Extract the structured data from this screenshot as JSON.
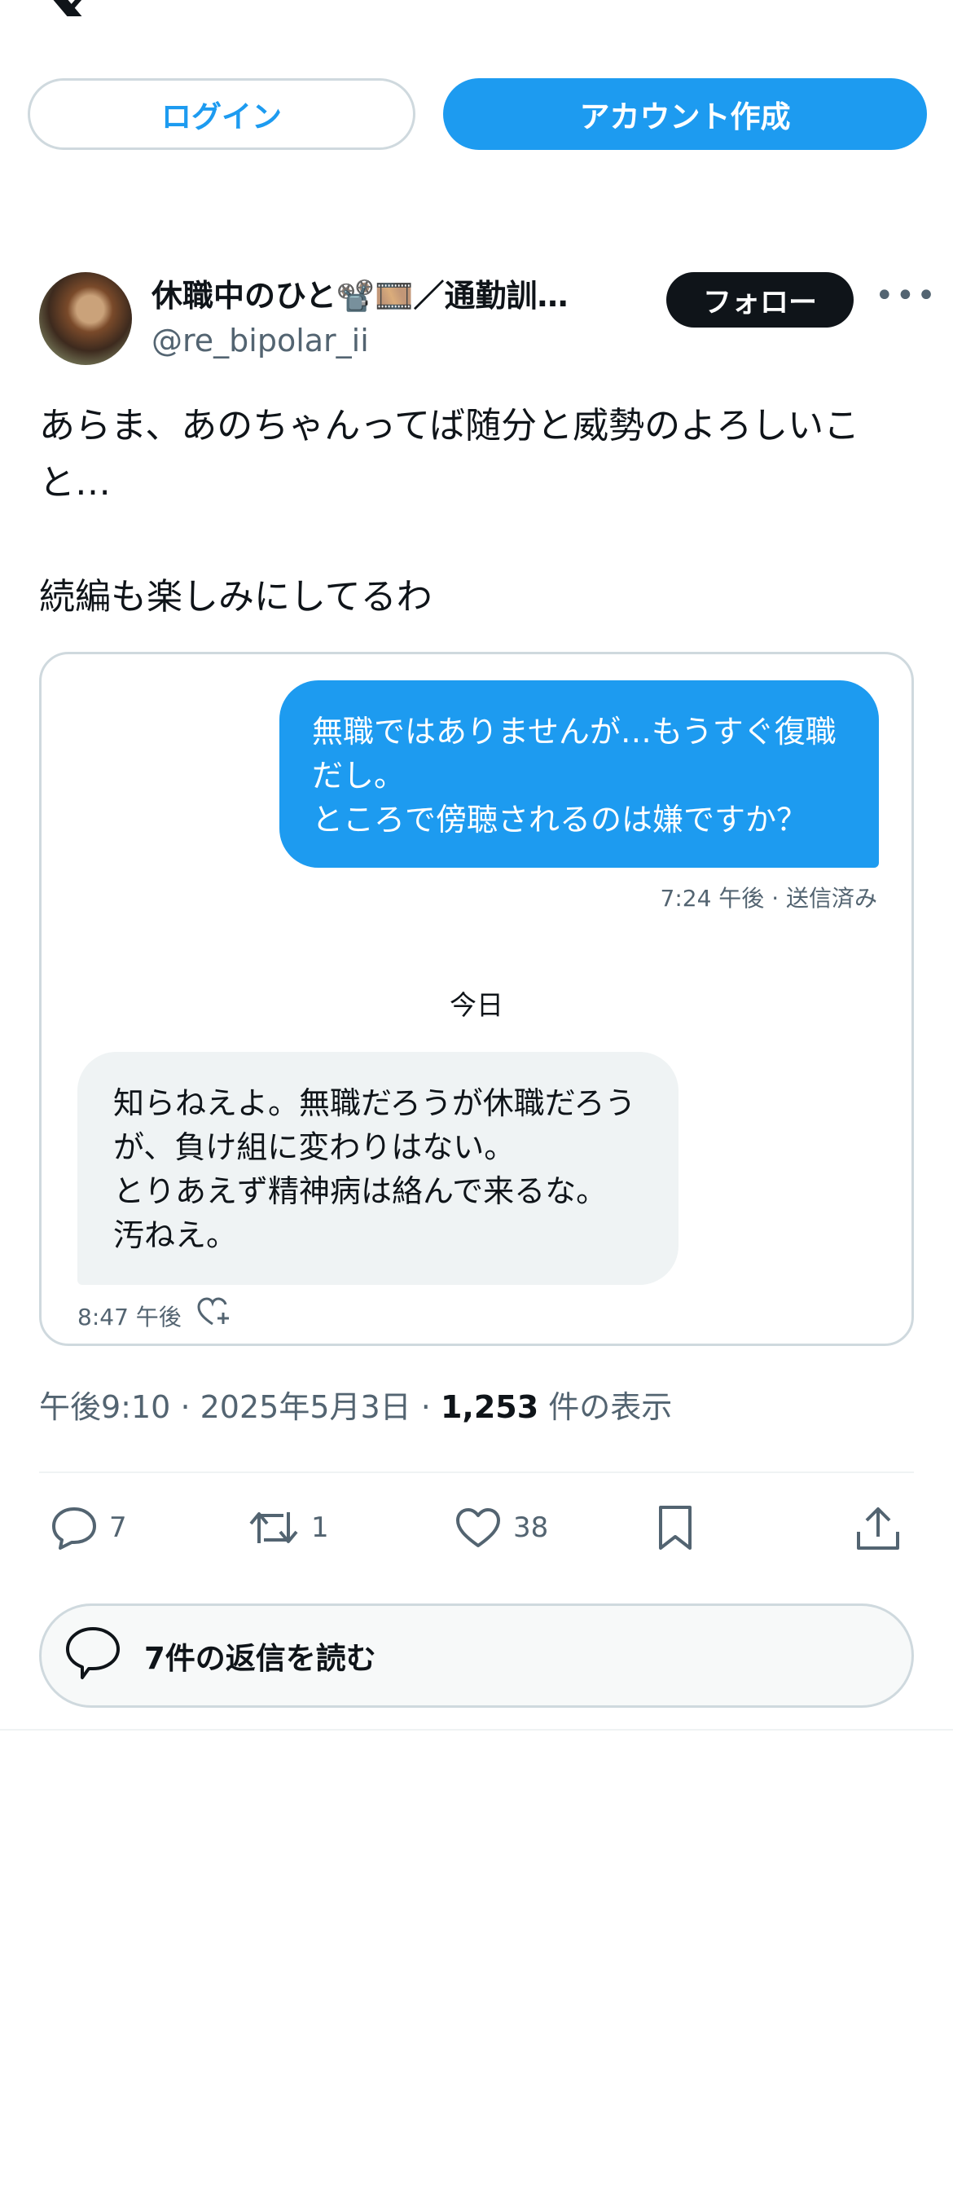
{
  "header": {
    "login_label": "ログイン",
    "signup_label": "アカウント作成"
  },
  "author": {
    "display_name": "休職中のひと📽️🎞️／通勤訓…",
    "handle": "@re_bipolar_ii",
    "follow_label": "フォロー"
  },
  "tweet": {
    "text": "あらま、あのちゃんってば随分と威勢のよろしいこと…\n\n続編も楽しみにしてるわ"
  },
  "card": {
    "outgoing_message": "無職ではありませんが…もうすぐ復職だし。\nところで傍聴されるのは嫌ですか？",
    "outgoing_meta": "7:24 午後 · 送信済み",
    "date_separator": "今日",
    "incoming_message": "知らねえよ。無職だろうが休職だろうが、負け組に変わりはない。\nとりあえず精神病は絡んで来るな。\n汚ねえ。",
    "incoming_time": "8:47 午後"
  },
  "meta": {
    "time": "午後9:10",
    "date": "2025年5月3日",
    "views_count": "1,253",
    "views_label": "件の表示",
    "separator": "·"
  },
  "actions": {
    "replies": "7",
    "retweets": "1",
    "likes": "38"
  },
  "read_replies_label": "7件の返信を読む",
  "colors": {
    "accent": "#1d9bf0",
    "text_primary": "#0f1419",
    "text_secondary": "#536471",
    "border": "#cfd9de"
  },
  "icons": [
    "x-logo-icon",
    "more-icon",
    "heart-plus-icon",
    "reply-icon",
    "retweet-icon",
    "like-icon",
    "bookmark-icon",
    "share-icon",
    "speech-bubble-icon"
  ]
}
